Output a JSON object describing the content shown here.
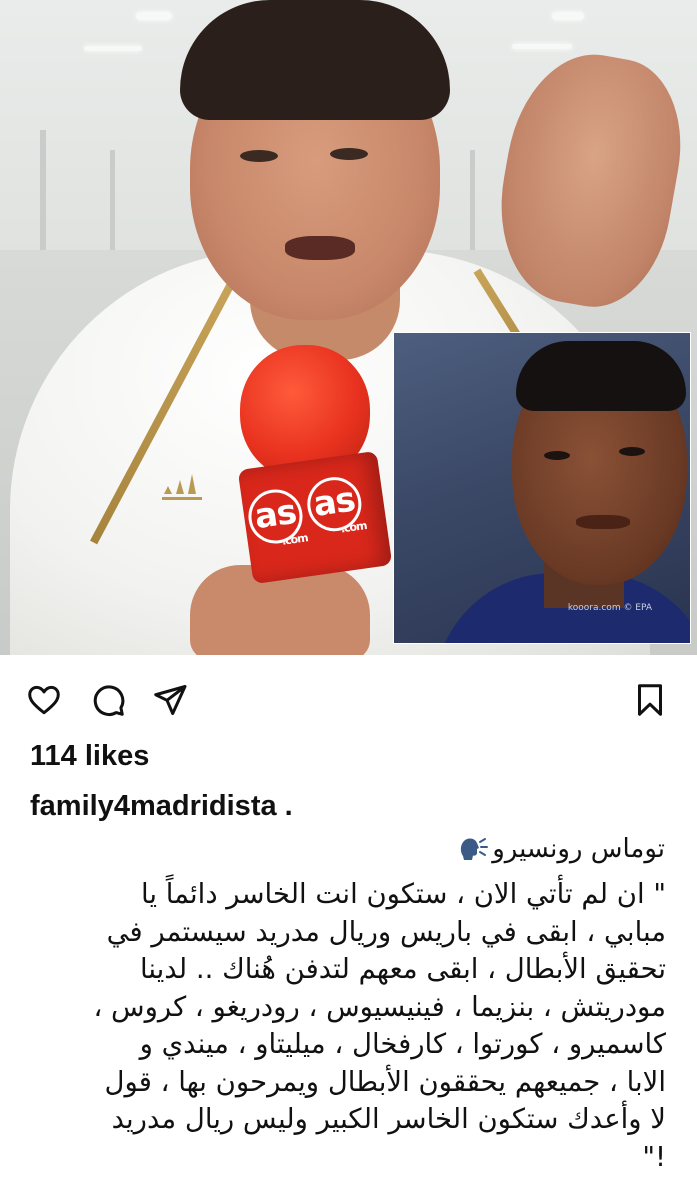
{
  "post": {
    "media": {
      "microphone_brand": "as",
      "microphone_brand_suffix": ".com",
      "jacket_brand": "adidas",
      "inset_credit": "kooora.com © EPA"
    },
    "actions": {
      "like": "heart-icon",
      "comment": "comment-icon",
      "share": "send-icon",
      "save": "bookmark-icon"
    },
    "likes": "114 likes",
    "username": "family4madridista .",
    "author_line": "توماس رونسيرو",
    "caption_lines": [
      "\" ان لم تأتي الان ، ستكون انت الخاسر دائماً يا",
      "مبابي ، ابقى في باريس وريال مدريد سيستمر في",
      "تحقيق الأبطال ، ابقى معهم لتدفن هُناك .. لدينا",
      "مودريتش ، بنزيما ، فينيسيوس ، رودريغو ، كروس ،",
      "كاسميرو ، كورتوا ، كارفخال ، ميليتاو ، ميندي و",
      "الابا ، جميعهم يحققون الأبطال ويمرحون بها ، قول",
      "لا وأعدك ستكون الخاسر الكبير وليس ريال مدريد",
      "!\""
    ]
  }
}
